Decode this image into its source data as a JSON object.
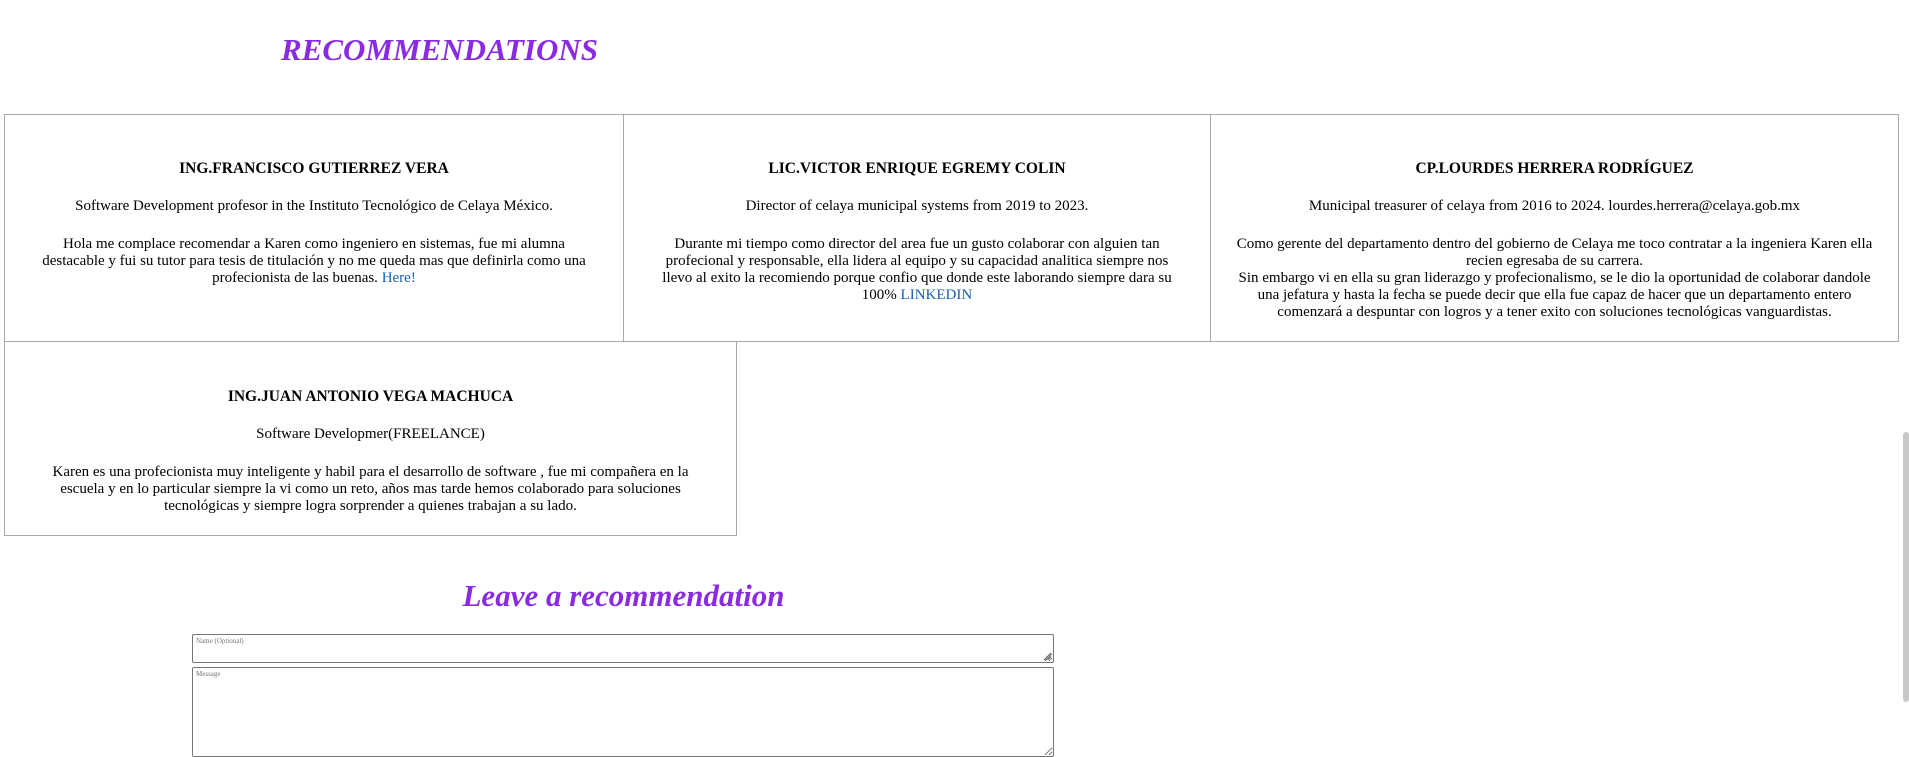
{
  "recommendations": {
    "title": "RECOMMENDATIONS",
    "cards": [
      {
        "name": "ING.FRANCISCO GUTIERREZ VERA",
        "role": "Software Development profesor in the Instituto Tecnológico de Celaya México.",
        "body": "Hola me complace recomendar a Karen como ingeniero en sistemas, fue mi alumna destacable y fui su tutor para tesis de titulación y no me queda mas que definirla como una profecionista de las buenas.",
        "link": "Here!"
      },
      {
        "name": "LIC.VICTOR ENRIQUE EGREMY COLIN",
        "role": "Director of celaya municipal systems from 2019 to 2023.",
        "body": "Durante mi tiempo como director del area fue un gusto colaborar con alguien tan profecional y responsable, ella lidera al equipo y su capacidad analitica siempre nos llevo al exito la recomiendo porque confio que donde este laborando siempre dara su 100%",
        "link": "LINKEDIN"
      },
      {
        "name": "CP.LOURDES HERRERA RODRÍGUEZ",
        "role": "Municipal treasurer of celaya from 2016 to 2024. lourdes.herrera@celaya.gob.mx",
        "body": "Como gerente del departamento dentro del gobierno de Celaya me toco contratar a la ingeniera Karen ella recien egresaba de su carrera.",
        "body2": "Sin embargo vi en ella su gran liderazgo y profecionalismo, se le dio la oportunidad de colaborar dandole una jefatura y hasta la fecha se puede decir que ella fue capaz de hacer que un departamento entero comenzará a despuntar con logros y a tener exito con soluciones tecnológicas vanguardistas."
      },
      {
        "name": "ING.JUAN ANTONIO VEGA MACHUCA",
        "role": "Software Developmer(FREELANCE)",
        "body": "Karen es una profecionista muy inteligente y habil para el desarrollo de software , fue mi compañera en la escuela y en lo particular siempre la vi como un reto, años mas tarde hemos colaborado para soluciones tecnológicas y siempre logra sorprender a quienes trabajan a su lado."
      }
    ]
  },
  "form": {
    "title": "Leave a recommendation",
    "name_placeholder": "Name (Optional)",
    "message_placeholder": "Message"
  },
  "colors": {
    "heading": "#8a2be2",
    "link": "#1a5fb4",
    "border": "#a9a9a9"
  }
}
